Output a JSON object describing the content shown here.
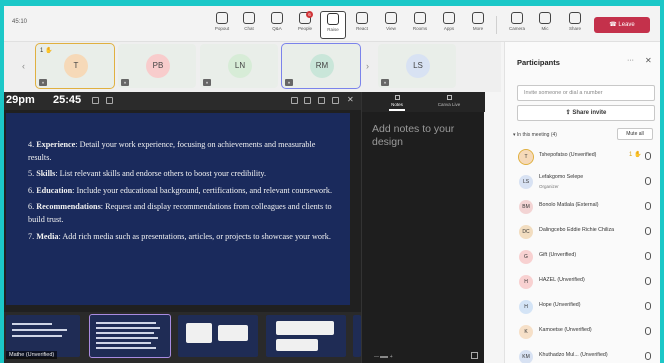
{
  "meeting": {
    "elapsed": "45:10"
  },
  "toolbar": {
    "items": [
      {
        "label": "Popout",
        "icon": "popout-icon"
      },
      {
        "label": "Chat",
        "icon": "chat-icon"
      },
      {
        "label": "Q&A",
        "icon": "qa-icon"
      },
      {
        "label": "People",
        "icon": "people-icon",
        "badge": "6"
      },
      {
        "label": "Raise",
        "icon": "raise-hand-icon"
      },
      {
        "label": "React",
        "icon": "react-icon"
      },
      {
        "label": "View",
        "icon": "view-icon"
      },
      {
        "label": "Rooms",
        "icon": "rooms-icon"
      },
      {
        "label": "Apps",
        "icon": "apps-icon"
      },
      {
        "label": "More",
        "icon": "more-icon"
      },
      {
        "label": "Camera",
        "icon": "camera-icon"
      },
      {
        "label": "Mic",
        "icon": "mic-icon"
      },
      {
        "label": "Share",
        "icon": "share-icon"
      }
    ],
    "leave_label": "Leave",
    "leave_color": "#c4314b"
  },
  "strip": {
    "tiles": [
      {
        "initials": "T",
        "color": "#f6d9b8"
      },
      {
        "initials": "PB",
        "color": "#f8cccc"
      },
      {
        "initials": "LN",
        "color": "#d7ecd7"
      },
      {
        "initials": "RM",
        "color": "#c9e6d9"
      },
      {
        "initials": "LS",
        "color": "#d8e2f3"
      }
    ],
    "hand_count": "1"
  },
  "presenter": {
    "clock": "29pm",
    "timer": "25:45",
    "name_label": "Mathe (Unverified)"
  },
  "slide": {
    "items": [
      {
        "num": "4.",
        "title": "Experience",
        "text": ": Detail your work experience, focusing on achievements and measurable results."
      },
      {
        "num": "5.",
        "title": "Skills",
        "text": ": List relevant skills and endorse others to boost your credibility."
      },
      {
        "num": "6.",
        "title": "Education",
        "text": ": Include your educational background, certifications, and relevant coursework."
      },
      {
        "num": "6.",
        "title": "Recommendations",
        "text": ": Request and display recommendations from colleagues and clients to build trust."
      },
      {
        "num": "7.",
        "title": "Media",
        "text": ": Add rich media such as presentations, articles, or projects to showcase your work."
      }
    ]
  },
  "notes": {
    "tabs": [
      {
        "label": "Notes"
      },
      {
        "label": "Canva Live"
      }
    ],
    "placeholder": "Add notes to your design"
  },
  "panel": {
    "title": "Participants",
    "search_placeholder": "Invite someone or dial a number",
    "share_invite": "Share invite",
    "section": "In this meeting (4)",
    "mute_all": "Mute all",
    "people": [
      {
        "initials": "T",
        "name": "Tshepofatso (Unverified)",
        "sub": "",
        "color": "#f6d9b8",
        "hand": true
      },
      {
        "initials": "LS",
        "name": "Lefakgomo Selepe",
        "sub": "Organizer",
        "color": "#d8e2f3",
        "hand": false
      },
      {
        "initials": "BM",
        "name": "Bonolo Matlala (External)",
        "sub": "",
        "color": "#f3d4d4",
        "hand": false
      },
      {
        "initials": "DC",
        "name": "Dalingcebo Eddie Richie Chiliza",
        "sub": "",
        "color": "#f2ddc0",
        "hand": false
      },
      {
        "initials": "G",
        "name": "Gift (Unverified)",
        "sub": "",
        "color": "#f8d1d1",
        "hand": false
      },
      {
        "initials": "H",
        "name": "HAZEL (Unverified)",
        "sub": "",
        "color": "#f8d1d1",
        "hand": false
      },
      {
        "initials": "H",
        "name": "Hope (Unverified)",
        "sub": "",
        "color": "#d4e4f6",
        "hand": false
      },
      {
        "initials": "K",
        "name": "Kamoetse (Unverified)",
        "sub": "",
        "color": "#f6e0c8",
        "hand": false
      },
      {
        "initials": "KM",
        "name": "Khuthadzo Mul... (Unverified)",
        "sub": "",
        "color": "#d8e2f3",
        "hand": false
      }
    ]
  },
  "zoom": {
    "level": "ok"
  }
}
